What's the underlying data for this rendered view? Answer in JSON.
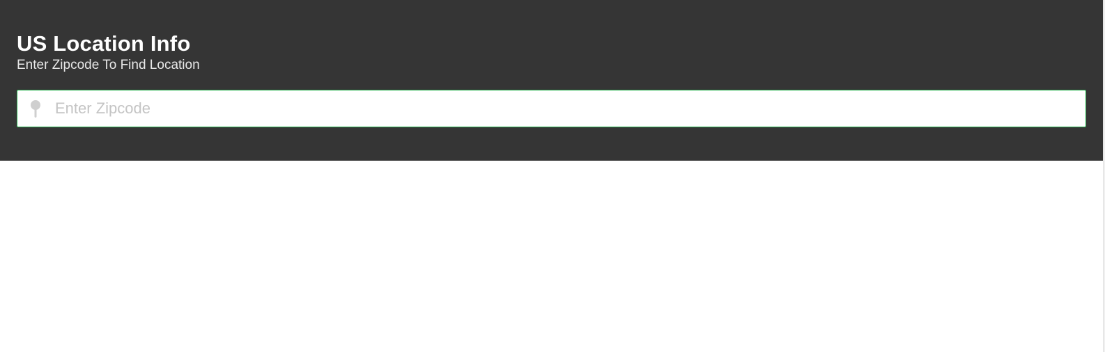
{
  "header": {
    "title": "US Location Info",
    "subtitle": "Enter Zipcode To Find Location"
  },
  "search": {
    "placeholder": "Enter Zipcode",
    "value": "",
    "icon": "map-pin-icon"
  },
  "colors": {
    "header_bg": "#353535",
    "accent_border": "#22b04a",
    "icon": "#cfcfcf"
  }
}
